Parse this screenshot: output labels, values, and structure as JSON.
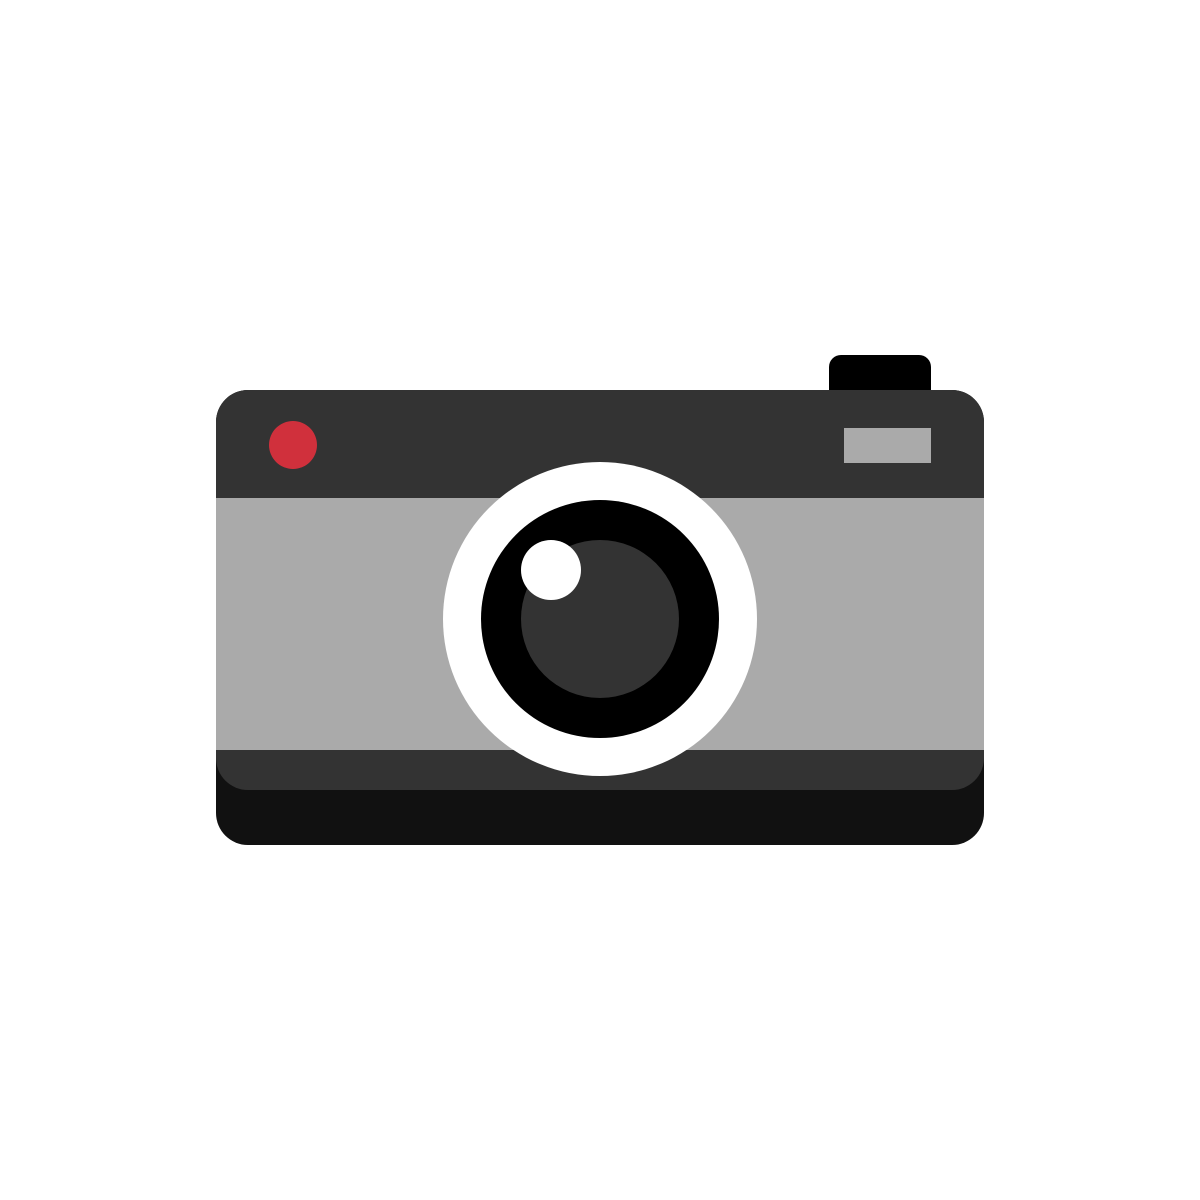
{
  "illustration": {
    "subject": "camera-icon",
    "background_color": "#ffffff",
    "colors": {
      "shutter_button": "#000000",
      "body_top": "#333333",
      "body_base": "#111111",
      "body_band": "#aaaaaa",
      "bottom_strip": "#333333",
      "indicator_light": "#d0303c",
      "viewfinder": "#aaaaaa",
      "lens_ring": "#ffffff",
      "lens_outer": "#000000",
      "lens_inner": "#333333",
      "lens_highlight": "#ffffff"
    }
  }
}
